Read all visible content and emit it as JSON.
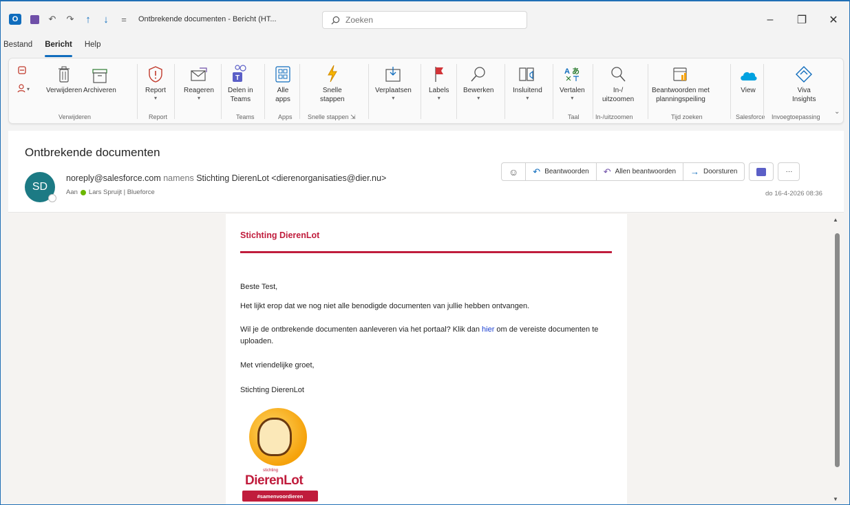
{
  "titlebar": {
    "title": "Ontbrekende documenten - Bericht (HT...",
    "search_placeholder": "Zoeken",
    "minimize": "–",
    "restore": "❐",
    "close": "✕"
  },
  "ribbon_tabs": [
    "Bestand",
    "Bericht",
    "Help"
  ],
  "ribbon": {
    "verwijderen": {
      "delete": "Verwijderen",
      "archive": "Archiveren",
      "group": "Verwijderen"
    },
    "report": {
      "label": "Report",
      "group": "Report"
    },
    "reply": {
      "label": "Reageren"
    },
    "teams": {
      "label1": "Delen in",
      "label2": "Teams",
      "group": "Teams"
    },
    "apps": {
      "label1": "Alle",
      "label2": "apps",
      "group": "Apps"
    },
    "quick": {
      "label1": "Snelle",
      "label2": "stappen",
      "group": "Snelle stappen"
    },
    "move": {
      "label": "Verplaatsen"
    },
    "labels": {
      "label": "Labels"
    },
    "edit": {
      "label": "Bewerken"
    },
    "immersive": {
      "label": "Insluitend"
    },
    "translate": {
      "label": "Vertalen",
      "group": "Taal"
    },
    "zoom": {
      "label1": "In-/",
      "label2": "uitzoomen",
      "group": "In-/uitzoomen"
    },
    "poll": {
      "label1": "Beantwoorden met",
      "label2": "planningspeiling",
      "group": "Tijd zoeken"
    },
    "view": {
      "label": "View",
      "group": "Salesforce"
    },
    "viva": {
      "label1": "Viva",
      "label2": "Insights",
      "group": "Invoegtoepassing"
    }
  },
  "message": {
    "subject": "Ontbrekende documenten",
    "avatar_initials": "SD",
    "from_address": "noreply@salesforce.com",
    "from_namens": "namens",
    "from_name": "Stichting DierenLot <dierenorganisaties@dier.nu>",
    "to_label": "Aan",
    "to_name": "Lars Spruijt | Blueforce",
    "date": "do 16-4-2026 08:36",
    "actions": {
      "reply": "Beantwoorden",
      "reply_all": "Allen beantwoorden",
      "forward": "Doorsturen",
      "more": "···"
    }
  },
  "email": {
    "org_title": "Stichting DierenLot",
    "greeting": "Beste Test,",
    "p1": "Het lijkt erop dat we nog niet alle benodigde documenten van jullie hebben ontvangen.",
    "p2_before": "Wil je de ontbrekende documenten aanleveren via het portaal? Klik dan ",
    "p2_link": "hier",
    "p2_after": " om de vereiste documenten te uploaden.",
    "closing": "Met vriendelijke groet,",
    "signature": "Stichting DierenLot",
    "logo_small": "stichting",
    "logo_name": "DierenLot",
    "logo_tag": "#samenvoordieren"
  },
  "colors": {
    "accent": "#0f6cbd",
    "brand_red": "#c01c3c",
    "avatar": "#1c7a84"
  }
}
